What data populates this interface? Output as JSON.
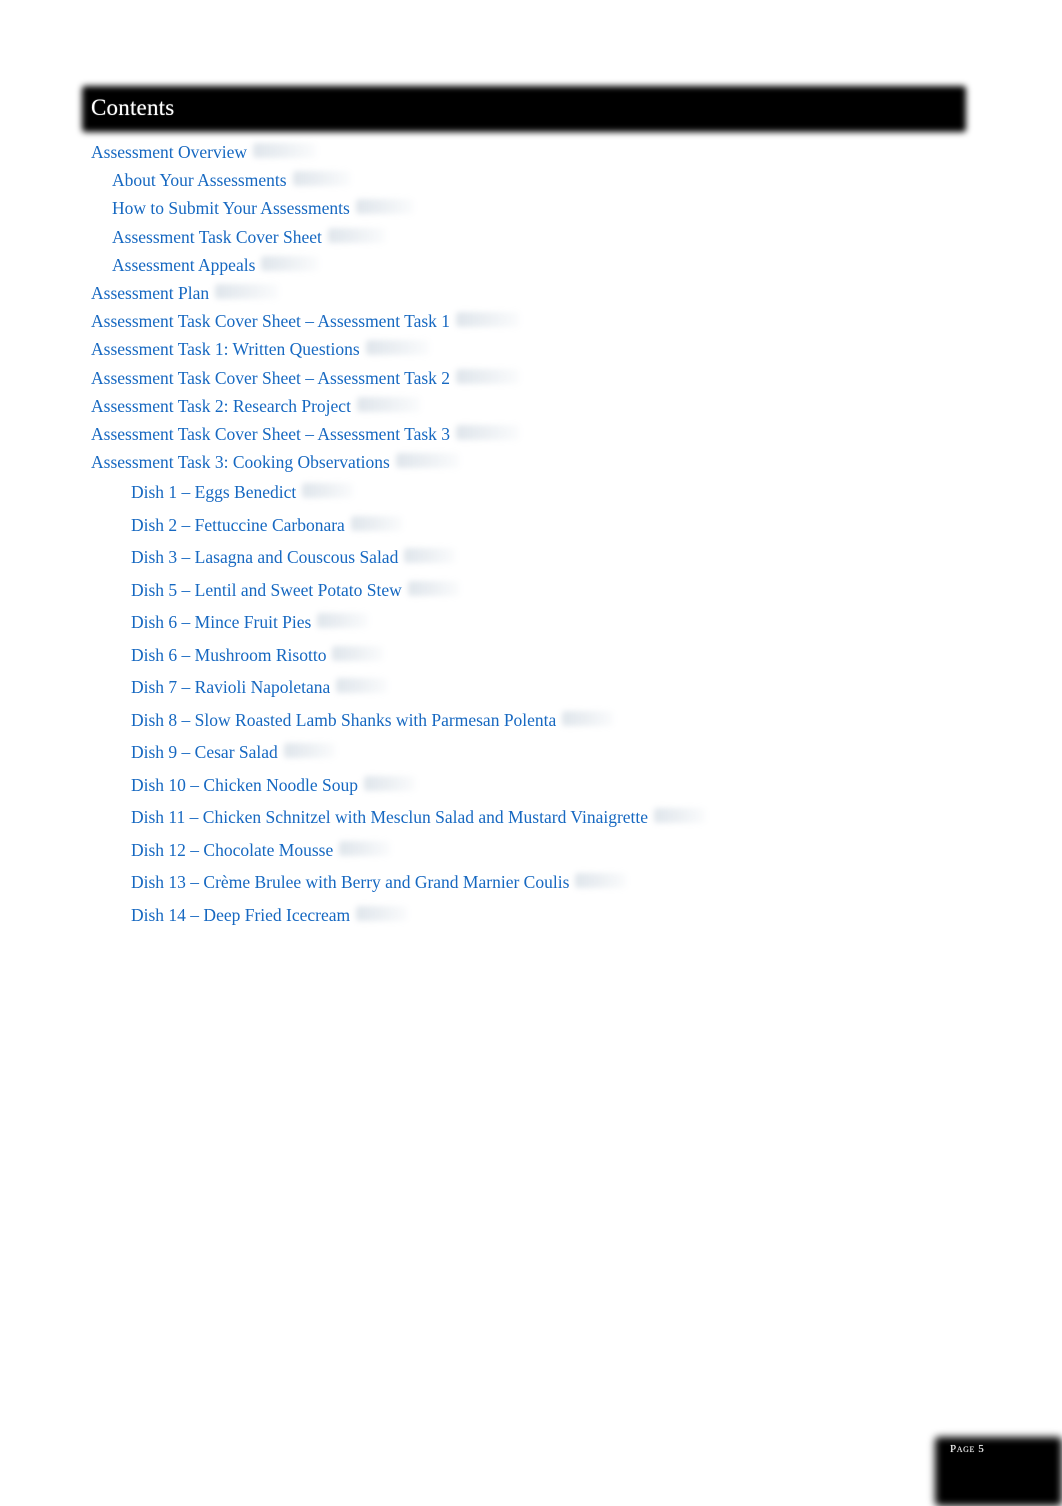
{
  "document": {
    "heading": "Contents",
    "link_color": "#1668c1",
    "banner_color": "#000000",
    "page_background": "#ffffff"
  },
  "toc": {
    "entries": [
      {
        "label": "Assessment Overview",
        "level": 1
      },
      {
        "label": "About Your Assessments",
        "level": 2
      },
      {
        "label": "How to Submit Your Assessments",
        "level": 2
      },
      {
        "label": "Assessment Task Cover Sheet",
        "level": 2
      },
      {
        "label": "Assessment Appeals",
        "level": 2
      },
      {
        "label": "Assessment Plan",
        "level": 1
      },
      {
        "label": "Assessment Task Cover Sheet – Assessment Task 1",
        "level": 1
      },
      {
        "label": "Assessment Task 1: Written Questions",
        "level": 1
      },
      {
        "label": "Assessment Task Cover Sheet – Assessment Task 2",
        "level": 1
      },
      {
        "label": "Assessment Task 2: Research Project",
        "level": 1
      },
      {
        "label": "Assessment Task Cover Sheet – Assessment Task 3",
        "level": 1
      },
      {
        "label": "Assessment Task 3: Cooking Observations",
        "level": 1
      },
      {
        "label": "Dish 1 – Eggs Benedict",
        "level": 3
      },
      {
        "label": "Dish 2 – Fettuccine Carbonara",
        "level": 3
      },
      {
        "label": "Dish 3 – Lasagna and Couscous Salad",
        "level": 3
      },
      {
        "label": "Dish 5 – Lentil and Sweet Potato Stew",
        "level": 3
      },
      {
        "label": "Dish 6 – Mince Fruit Pies",
        "level": 3
      },
      {
        "label": "Dish 6 – Mushroom Risotto",
        "level": 3
      },
      {
        "label": "Dish 7 – Ravioli Napoletana",
        "level": 3
      },
      {
        "label": "Dish 8 – Slow Roasted Lamb Shanks with Parmesan Polenta",
        "level": 3
      },
      {
        "label": "Dish 9 – Cesar Salad",
        "level": 3
      },
      {
        "label": "Dish 10 – Chicken Noodle Soup",
        "level": 3
      },
      {
        "label": "Dish 11 – Chicken Schnitzel with Mesclun Salad and Mustard Vinaigrette",
        "level": 3
      },
      {
        "label": "Dish 12 – Chocolate Mousse",
        "level": 3
      },
      {
        "label": "Dish 13 – Crème Brulee with Berry and Grand Marnier Coulis",
        "level": 3
      },
      {
        "label": "Dish 14 – Deep Fried Icecream",
        "level": 3
      }
    ]
  },
  "footer": {
    "page_label": "Page 5"
  }
}
